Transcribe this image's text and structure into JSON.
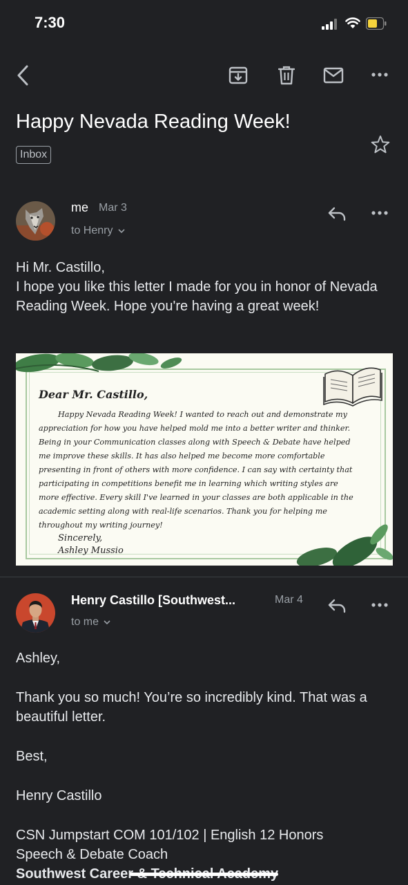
{
  "status_bar": {
    "time": "7:30"
  },
  "toolbar": {
    "back": "back-arrow",
    "archive": "archive-icon",
    "delete": "trash-icon",
    "mark_unread": "mail-icon",
    "more": "more-icon"
  },
  "thread": {
    "subject": "Happy Nevada Reading Week!",
    "label": "Inbox"
  },
  "messages": [
    {
      "sender": "me",
      "date": "Mar 3",
      "to": "to Henry",
      "body": [
        "Hi Mr. Castillo,",
        "I hope you like this letter I made for you in honor of Nevada Reading Week. Hope you're having a great week!"
      ],
      "attachment": {
        "greeting": "Dear Mr. Castillo,",
        "body": "Happy Nevada Reading Week! I wanted to reach out and demonstrate my appreciation for how you have helped mold me into a better writer and thinker. Being in your Communication classes along with Speech & Debate have helped me improve these skills. It has also helped me become more comfortable presenting in front of others with more confidence. I can say with certainty that participating in competitions benefit me in learning which writing styles are more effective. Every skill I've learned in your classes are both applicable in the academic setting along with real-life scenarios. Thank you for helping me throughout my writing journey!",
        "closing": "Sincerely,",
        "signature": "Ashley Mussio"
      }
    },
    {
      "sender": "Henry Castillo [Southwest...",
      "date": "Mar 4",
      "to": "to me",
      "body": [
        "Ashley,",
        "Thank you so much! You’re so incredibly kind. That was a beautiful letter.",
        "Best,",
        "Henry Castillo",
        "CSN Jumpstart COM 101/102 | English 12 Honors",
        "Speech & Debate Coach",
        "Southwest Career & Technical Academy"
      ]
    }
  ],
  "colors": {
    "background": "#202124",
    "text": "#e8eaed",
    "secondary": "#9aa0a6",
    "battery": "#f5d33c"
  }
}
